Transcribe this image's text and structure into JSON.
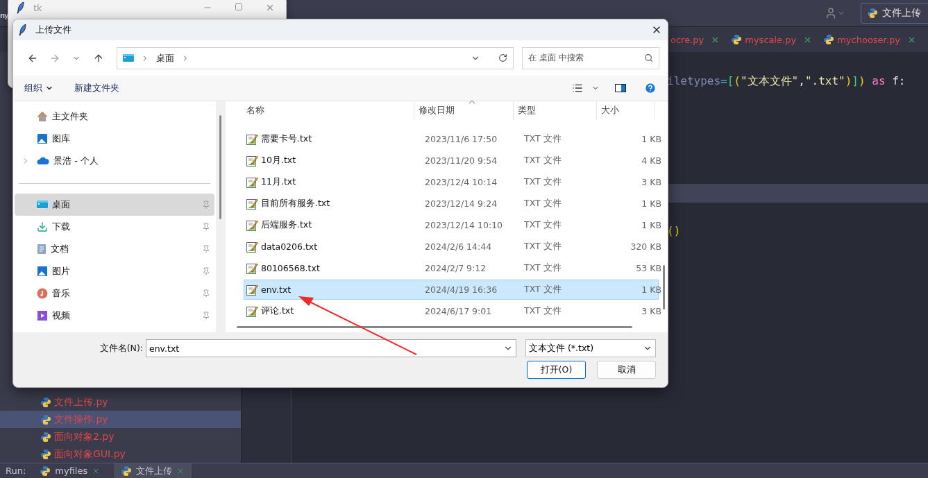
{
  "ide": {
    "top_bar": {
      "partial_title": "ny",
      "run_config": "文件上传"
    },
    "editor_tabs": [
      {
        "label": "ocre.py",
        "selected": false
      },
      {
        "label": "myscale.py",
        "selected": false
      },
      {
        "label": "mychooser.py",
        "selected": false
      }
    ],
    "code_lines": [
      {
        "segments": [
          {
            "kind": "ident",
            "text": "iletypes"
          },
          {
            "kind": "op",
            "text": "="
          },
          {
            "kind": "bracket2",
            "text": "["
          },
          {
            "kind": "bracket1",
            "text": "("
          },
          {
            "kind": "string",
            "text": "\"文本文件\""
          },
          {
            "kind": "plain",
            "text": ","
          },
          {
            "kind": "string",
            "text": "\".txt\""
          },
          {
            "kind": "bracket1",
            "text": ")"
          },
          {
            "kind": "bracket2",
            "text": "]"
          },
          {
            "kind": "bracket1",
            "text": ")"
          },
          {
            "kind": "keyword",
            "text": " as"
          },
          {
            "kind": "plain",
            "text": " f:"
          }
        ]
      },
      {
        "segments": [
          {
            "kind": "bracket1",
            "text": "()"
          }
        ]
      }
    ],
    "project_tree": [
      {
        "label": "文件上传.py",
        "selected": false
      },
      {
        "label": "文件操作.py",
        "selected": true
      },
      {
        "label": "面向对象2.py",
        "selected": false
      },
      {
        "label": "面向对象GUI.py",
        "selected": false
      }
    ],
    "run_bar": {
      "label": "Run:",
      "tabs": [
        {
          "label": "myfiles",
          "selected": false
        },
        {
          "label": "文件上传",
          "selected": true
        }
      ]
    }
  },
  "tk_window": {
    "title": "tk"
  },
  "dialog": {
    "title": "上传文件",
    "forward_button": {
      "disabled": true
    },
    "breadcrumb": [
      "桌面"
    ],
    "search": {
      "placeholder": "在 桌面 中搜索"
    },
    "toolbar": {
      "organize": "组织",
      "new_folder": "新建文件夹"
    },
    "nav_top": [
      {
        "label": "主文件夹",
        "expandable": false
      },
      {
        "label": "图库",
        "expandable": false
      },
      {
        "label": "景浩 - 个人",
        "expandable": true
      }
    ],
    "nav_pinned": [
      {
        "label": "桌面",
        "selected": true
      },
      {
        "label": "下载",
        "selected": false
      },
      {
        "label": "文档",
        "selected": false
      },
      {
        "label": "图片",
        "selected": false
      },
      {
        "label": "音乐",
        "selected": false
      },
      {
        "label": "视频",
        "selected": false
      }
    ],
    "columns": [
      "名称",
      "修改日期",
      "类型",
      "大小"
    ],
    "rows": [
      {
        "name": "需要卡号.txt",
        "date": "2023/11/6 17:50",
        "type": "TXT 文件",
        "size": "1 KB",
        "selected": false
      },
      {
        "name": "10月.txt",
        "date": "2023/11/20 9:54",
        "type": "TXT 文件",
        "size": "4 KB",
        "selected": false
      },
      {
        "name": "11月.txt",
        "date": "2023/12/4 10:14",
        "type": "TXT 文件",
        "size": "3 KB",
        "selected": false
      },
      {
        "name": "目前所有服务.txt",
        "date": "2023/12/14 9:24",
        "type": "TXT 文件",
        "size": "1 KB",
        "selected": false
      },
      {
        "name": "后端服务.txt",
        "date": "2023/12/14 10:10",
        "type": "TXT 文件",
        "size": "1 KB",
        "selected": false
      },
      {
        "name": "data0206.txt",
        "date": "2024/2/6 14:44",
        "type": "TXT 文件",
        "size": "320 KB",
        "selected": false
      },
      {
        "name": "80106568.txt",
        "date": "2024/2/7 9:12",
        "type": "TXT 文件",
        "size": "53 KB",
        "selected": false
      },
      {
        "name": "env.txt",
        "date": "2024/4/19 16:36",
        "type": "TXT 文件",
        "size": "1 KB",
        "selected": true
      },
      {
        "name": "评论.txt",
        "date": "2024/6/17 9:01",
        "type": "TXT 文件",
        "size": "3 KB",
        "selected": false
      }
    ],
    "filename": {
      "label": "文件名(N):",
      "value": "env.txt"
    },
    "filter": "文本文件 (*.txt)",
    "buttons": [
      {
        "label": "打开(O)",
        "kind": "default"
      },
      {
        "label": "取消",
        "kind": "normal"
      }
    ]
  },
  "annotation": {
    "kind": "arrow"
  }
}
